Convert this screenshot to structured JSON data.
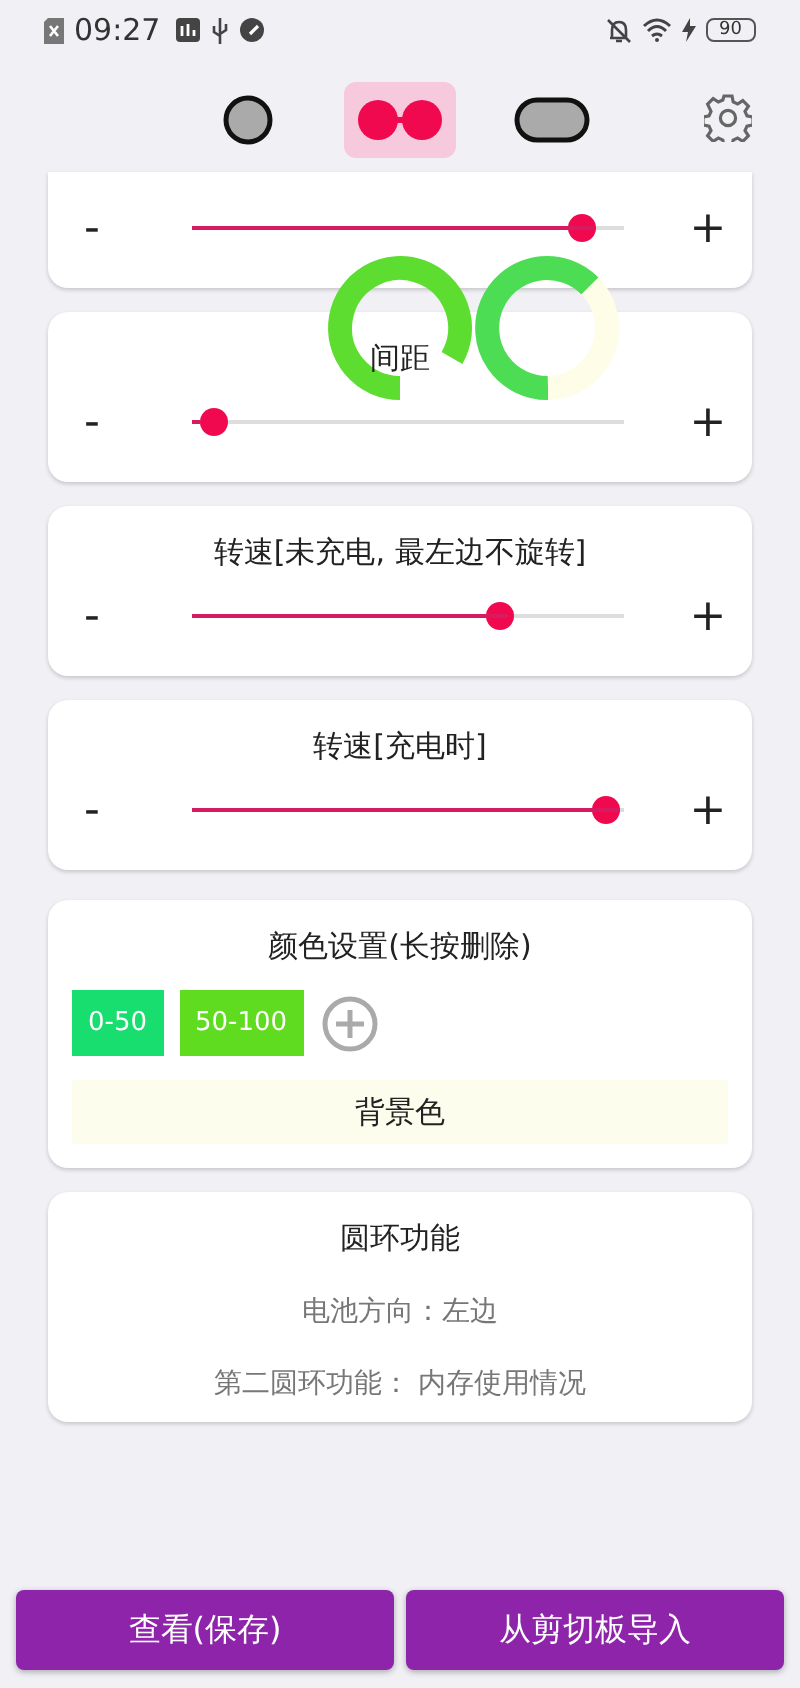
{
  "status_bar": {
    "time": "09:27",
    "battery": "90"
  },
  "tabs": [
    {
      "kind": "circle",
      "selected": false
    },
    {
      "kind": "double",
      "selected": true
    },
    {
      "kind": "pill",
      "selected": false
    }
  ],
  "sliders": [
    {
      "level": 0.93
    },
    {
      "title": "间距",
      "level": 0.02
    },
    {
      "title": "转速[未充电, 最左边不旋转]",
      "level": 0.73
    },
    {
      "title": "转速[充电时]",
      "level": 0.99
    }
  ],
  "minus": "-",
  "plus": "+",
  "color_settings": {
    "title": "颜色设置(长按删除)",
    "swatches": [
      {
        "label": "0-50",
        "color": "#17de6e"
      },
      {
        "label": "50-100",
        "color": "#5fdc1f"
      }
    ],
    "background_label": "背景色"
  },
  "ring_function": {
    "title": "圆环功能",
    "items": [
      "电池方向：左边",
      "第二圆环功能： 内存使用情况"
    ]
  },
  "buttons": [
    "查看(保存)",
    "从剪切板导入"
  ]
}
